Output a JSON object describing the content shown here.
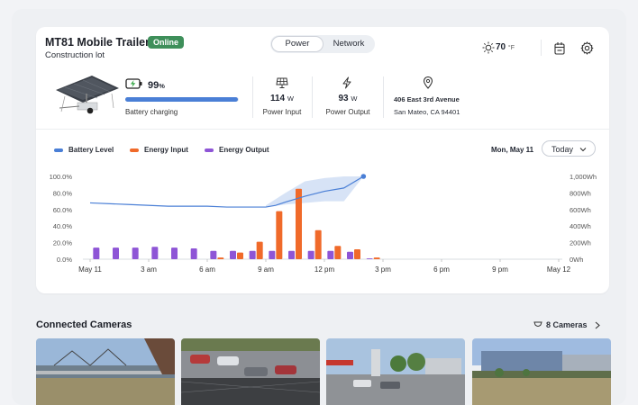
{
  "header": {
    "title": "MT81 Mobile Trailer",
    "status": "Online",
    "subtitle": "Construction lot",
    "tabs": [
      {
        "label": "Power"
      },
      {
        "label": "Network"
      }
    ],
    "temperature": "70",
    "temperature_unit": "°F"
  },
  "battery": {
    "percent": "99",
    "percent_unit": "%",
    "percent_value": 0.99,
    "status": "Battery charging"
  },
  "stats": {
    "power_input_value": "114",
    "power_input_unit": "W",
    "power_input_label": "Power Input",
    "power_output_value": "93",
    "power_output_unit": "W",
    "power_output_label": "Power Output",
    "address_line1": "406 East 3rd Avenue",
    "address_line2": "San Mateo, CA 94401"
  },
  "chart_controls": {
    "legend": [
      "Battery Level",
      "Energy Input",
      "Energy Output"
    ],
    "date": "Mon, May 11",
    "range_label": "Today"
  },
  "colors": {
    "battery": "#4a7fd6",
    "input": "#f06a2a",
    "output": "#8e55d6",
    "online": "#3e8f5a"
  },
  "chart_data": {
    "type": "bar",
    "x_tick_labels": [
      "May 11",
      "3 am",
      "6 am",
      "9 am",
      "12 pm",
      "3 pm",
      "6 pm",
      "9 pm",
      "May 12"
    ],
    "y_left_ticks": [
      "100.0%",
      "80.0%",
      "60.0%",
      "40.0%",
      "20.0%",
      "0.0%"
    ],
    "y_right_ticks": [
      "1,000Wh",
      "800Wh",
      "600Wh",
      "400Wh",
      "200Wh",
      "0Wh"
    ],
    "ylim_left": [
      0,
      100
    ],
    "ylim_right": [
      0,
      1000
    ],
    "hours": [
      0,
      1,
      2,
      3,
      4,
      5,
      6,
      7,
      8,
      9,
      10,
      11,
      12,
      13,
      14
    ],
    "series": [
      {
        "name": "Energy Input",
        "axis": "right",
        "values": [
          0,
          0,
          0,
          0,
          0,
          0,
          20,
          80,
          210,
          580,
          850,
          350,
          160,
          120,
          20
        ]
      },
      {
        "name": "Energy Output",
        "axis": "right",
        "values": [
          140,
          140,
          140,
          150,
          140,
          130,
          100,
          100,
          100,
          100,
          100,
          100,
          100,
          90,
          10
        ]
      },
      {
        "name": "Battery Level",
        "axis": "left",
        "x": [
          0,
          2,
          4,
          6,
          7,
          8,
          9,
          9.5,
          10,
          11,
          12,
          13,
          14
        ],
        "values": [
          68,
          66,
          64,
          64,
          63,
          63,
          63,
          65,
          69,
          76,
          82,
          86,
          100
        ]
      }
    ],
    "battery_band_upper": {
      "x": [
        9,
        10,
        11,
        12,
        13,
        14
      ],
      "values": [
        65,
        80,
        94,
        98,
        100,
        100
      ]
    },
    "battery_band_lower": {
      "x": [
        9,
        10,
        11,
        12,
        13,
        14
      ],
      "values": [
        63,
        66,
        68,
        70,
        70,
        100
      ]
    },
    "grid": false,
    "legend_position": "top-left"
  },
  "cameras": {
    "title": "Connected Cameras",
    "count_label": "8 Cameras"
  }
}
